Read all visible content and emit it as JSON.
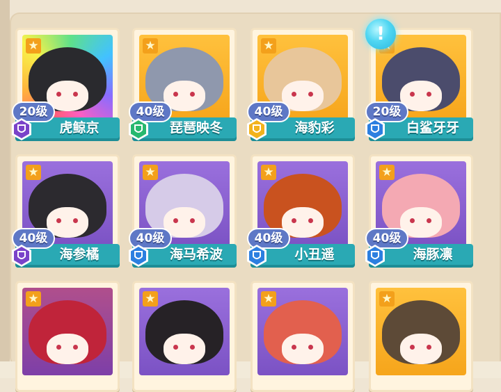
{
  "grid": {
    "cards": [
      {
        "level_label": "20级",
        "name": "虎鲸京",
        "rank": "purple",
        "bg": "rainbow",
        "hair_color": "#2a2a2e"
      },
      {
        "level_label": "40级",
        "name": "琵琶映冬",
        "rank": "green",
        "bg": "orange",
        "hair_color": "#8f98ad"
      },
      {
        "level_label": "40级",
        "name": "海豹彩",
        "rank": "gold",
        "bg": "orange",
        "hair_color": "#e8c69a"
      },
      {
        "level_label": "20级",
        "name": "白鲨牙牙",
        "rank": "blue",
        "bg": "orange",
        "hair_color": "#4b4c6c"
      },
      {
        "level_label": "40级",
        "name": "海参橘",
        "rank": "purple",
        "bg": "purple",
        "hair_color": "#2c2a2f"
      },
      {
        "level_label": "40级",
        "name": "海马希波",
        "rank": "blue",
        "bg": "purple",
        "hair_color": "#d6cbe8"
      },
      {
        "level_label": "40级",
        "name": "小丑遥",
        "rank": "blue",
        "bg": "purple",
        "hair_color": "#c9521f"
      },
      {
        "level_label": "40级",
        "name": "海豚凛",
        "rank": "blue",
        "bg": "purple",
        "hair_color": "#f4a9b3"
      },
      {
        "bg": "red",
        "hair_color": "#c0243a"
      },
      {
        "bg": "purple",
        "hair_color": "#262226"
      },
      {
        "bg": "purple",
        "hair_color": "#e2604e"
      },
      {
        "bg": "orange",
        "hair_color": "#5d4a37"
      }
    ]
  },
  "alert_icon": "exclamation-icon",
  "colors": {
    "name_bar": "#2aa9b4",
    "level_badge": "#5e78c6",
    "star_badge": "#f3a01b",
    "rank_purple": "#7a43c9",
    "rank_green": "#27b86e",
    "rank_gold": "#f2b31b",
    "rank_blue": "#2c7fe0"
  }
}
